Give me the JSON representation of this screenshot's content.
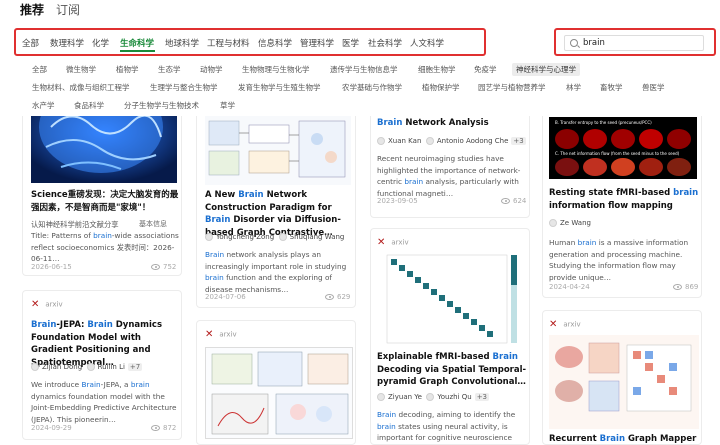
{
  "top_tabs": {
    "recommend": "推荐",
    "subscribe": "订阅"
  },
  "categories": [
    "全部",
    "数理科学",
    "化学",
    "生命科学",
    "地球科学",
    "工程与材料",
    "信息科学",
    "管理科学",
    "医学",
    "社会科学",
    "人文科学"
  ],
  "active_category": "生命科学",
  "search": {
    "value": "brain"
  },
  "subcategories": {
    "row1": [
      "全部",
      "微生物学",
      "植物学",
      "生态学",
      "动物学",
      "生物物理与生物化学",
      "遗传学与生物信息学",
      "细胞生物学",
      "免疫学",
      "神经科学与心理学"
    ],
    "row2": [
      "生物材料、成像与组织工程学",
      "生理学与整合生物学",
      "发育生物学与生殖生物学",
      "农学基础与作物学",
      "植物保护学",
      "园艺学与植物营养学",
      "林学",
      "畜牧学",
      "兽医学"
    ],
    "row3": [
      "水产学",
      "食品科学",
      "分子生物学与生物技术",
      "草学"
    ],
    "active": "神经科学与心理学"
  },
  "cards": {
    "c1": {
      "title": "Science重磅发现：决定大脑发育的最强因素，不是智商而是\"家境\"！",
      "source": "认知神经科学前沿文献分享",
      "tag": "基本信息",
      "desc_a": "Title: Patterns of ",
      "desc_hl": "brain",
      "desc_b": "-wide associations reflect socioeconomics 发表时间：2026-06-11…",
      "date": "2026-06-15",
      "views": "752"
    },
    "c2": {
      "title_a": "A New ",
      "title_hl": "Brain",
      "title_b": " Network Construction Paradigm for ",
      "title_hl2": "Brain",
      "title_c": " Disorder via Diffusion-based Graph Contrastive…",
      "author1": "Yongcheng Zong",
      "author2": "Shuqiang Wang",
      "desc_hl": "Brain",
      "desc_a": " network analysis plays an increasingly important role in studying ",
      "desc_hl2": "brain",
      "desc_b": " function and the exploring of disease mechanisms…",
      "date": "2024-07-06",
      "views": "629"
    },
    "c3": {
      "title_hl": "Brain",
      "title_a": " Network Analysis",
      "author1": "Xuan Kan",
      "author2": "Antonio Aodong Che",
      "more": "+3",
      "desc_a": "Recent neuroimaging studies have highlighted the importance of network-centric ",
      "desc_hl": "brain",
      "desc_b": " analysis, particularly with functional magneti…",
      "date": "2023-09-05",
      "views": "624"
    },
    "c4": {
      "title_a": "Resting state fMRI-based ",
      "title_hl": "brain",
      "title_b": " information flow mapping",
      "author1": "Ze Wang",
      "desc_a": "Human ",
      "desc_hl": "brain",
      "desc_b": " is a massive information generation and processing machine. Studying the information flow may provide unique…",
      "date": "2024-04-24",
      "views": "869",
      "fig_caption1": "B. Transfer entropy to the seed (precuneus/PCC)",
      "fig_caption2": "C. The net information flow (from the seed minus to the seed)"
    },
    "c5": {
      "source": "arxiv",
      "title_hl": "Brain",
      "title_a": "-JEPA: ",
      "title_hl2": "Brain",
      "title_b": " Dynamics Foundation Model with Gradient Positioning and Spatiotemporal…",
      "author1": "Zijian Dong",
      "author2": "Ruilin Li",
      "more": "+7",
      "desc_a": "We introduce ",
      "desc_hl": "Brain",
      "desc_b": "-JEPA, a ",
      "desc_hl2": "brain",
      "desc_c": " dynamics foundation model with the Joint-Embedding Predictive Architecture (JEPA). This pioneerin…",
      "date": "2024-09-29",
      "views": "872"
    },
    "c6": {
      "source": "arxiv"
    },
    "c7": {
      "source": "arxiv",
      "title_a": "Explainable fMRI-based ",
      "title_hl": "Brain",
      "title_b": " Decoding via Spatial Temporal-pyramid Graph Convolutional…",
      "author1": "Ziyuan Ye",
      "author2": "Youzhi Qu",
      "more": "+3",
      "desc_hl": "Brain",
      "desc_a": " decoding, aiming to identify the ",
      "desc_hl2": "brain",
      "desc_b": " states using neural activity, is important for cognitive neuroscience and neural…"
    },
    "c8": {
      "source": "arxiv",
      "title_a": "Recurrent ",
      "title_hl": "Brain",
      "title_b": " Graph Mapper for"
    }
  },
  "colors": {
    "accent": "#1a8a3a",
    "highlight": "#1a6fd0",
    "outline": "#e03030"
  }
}
